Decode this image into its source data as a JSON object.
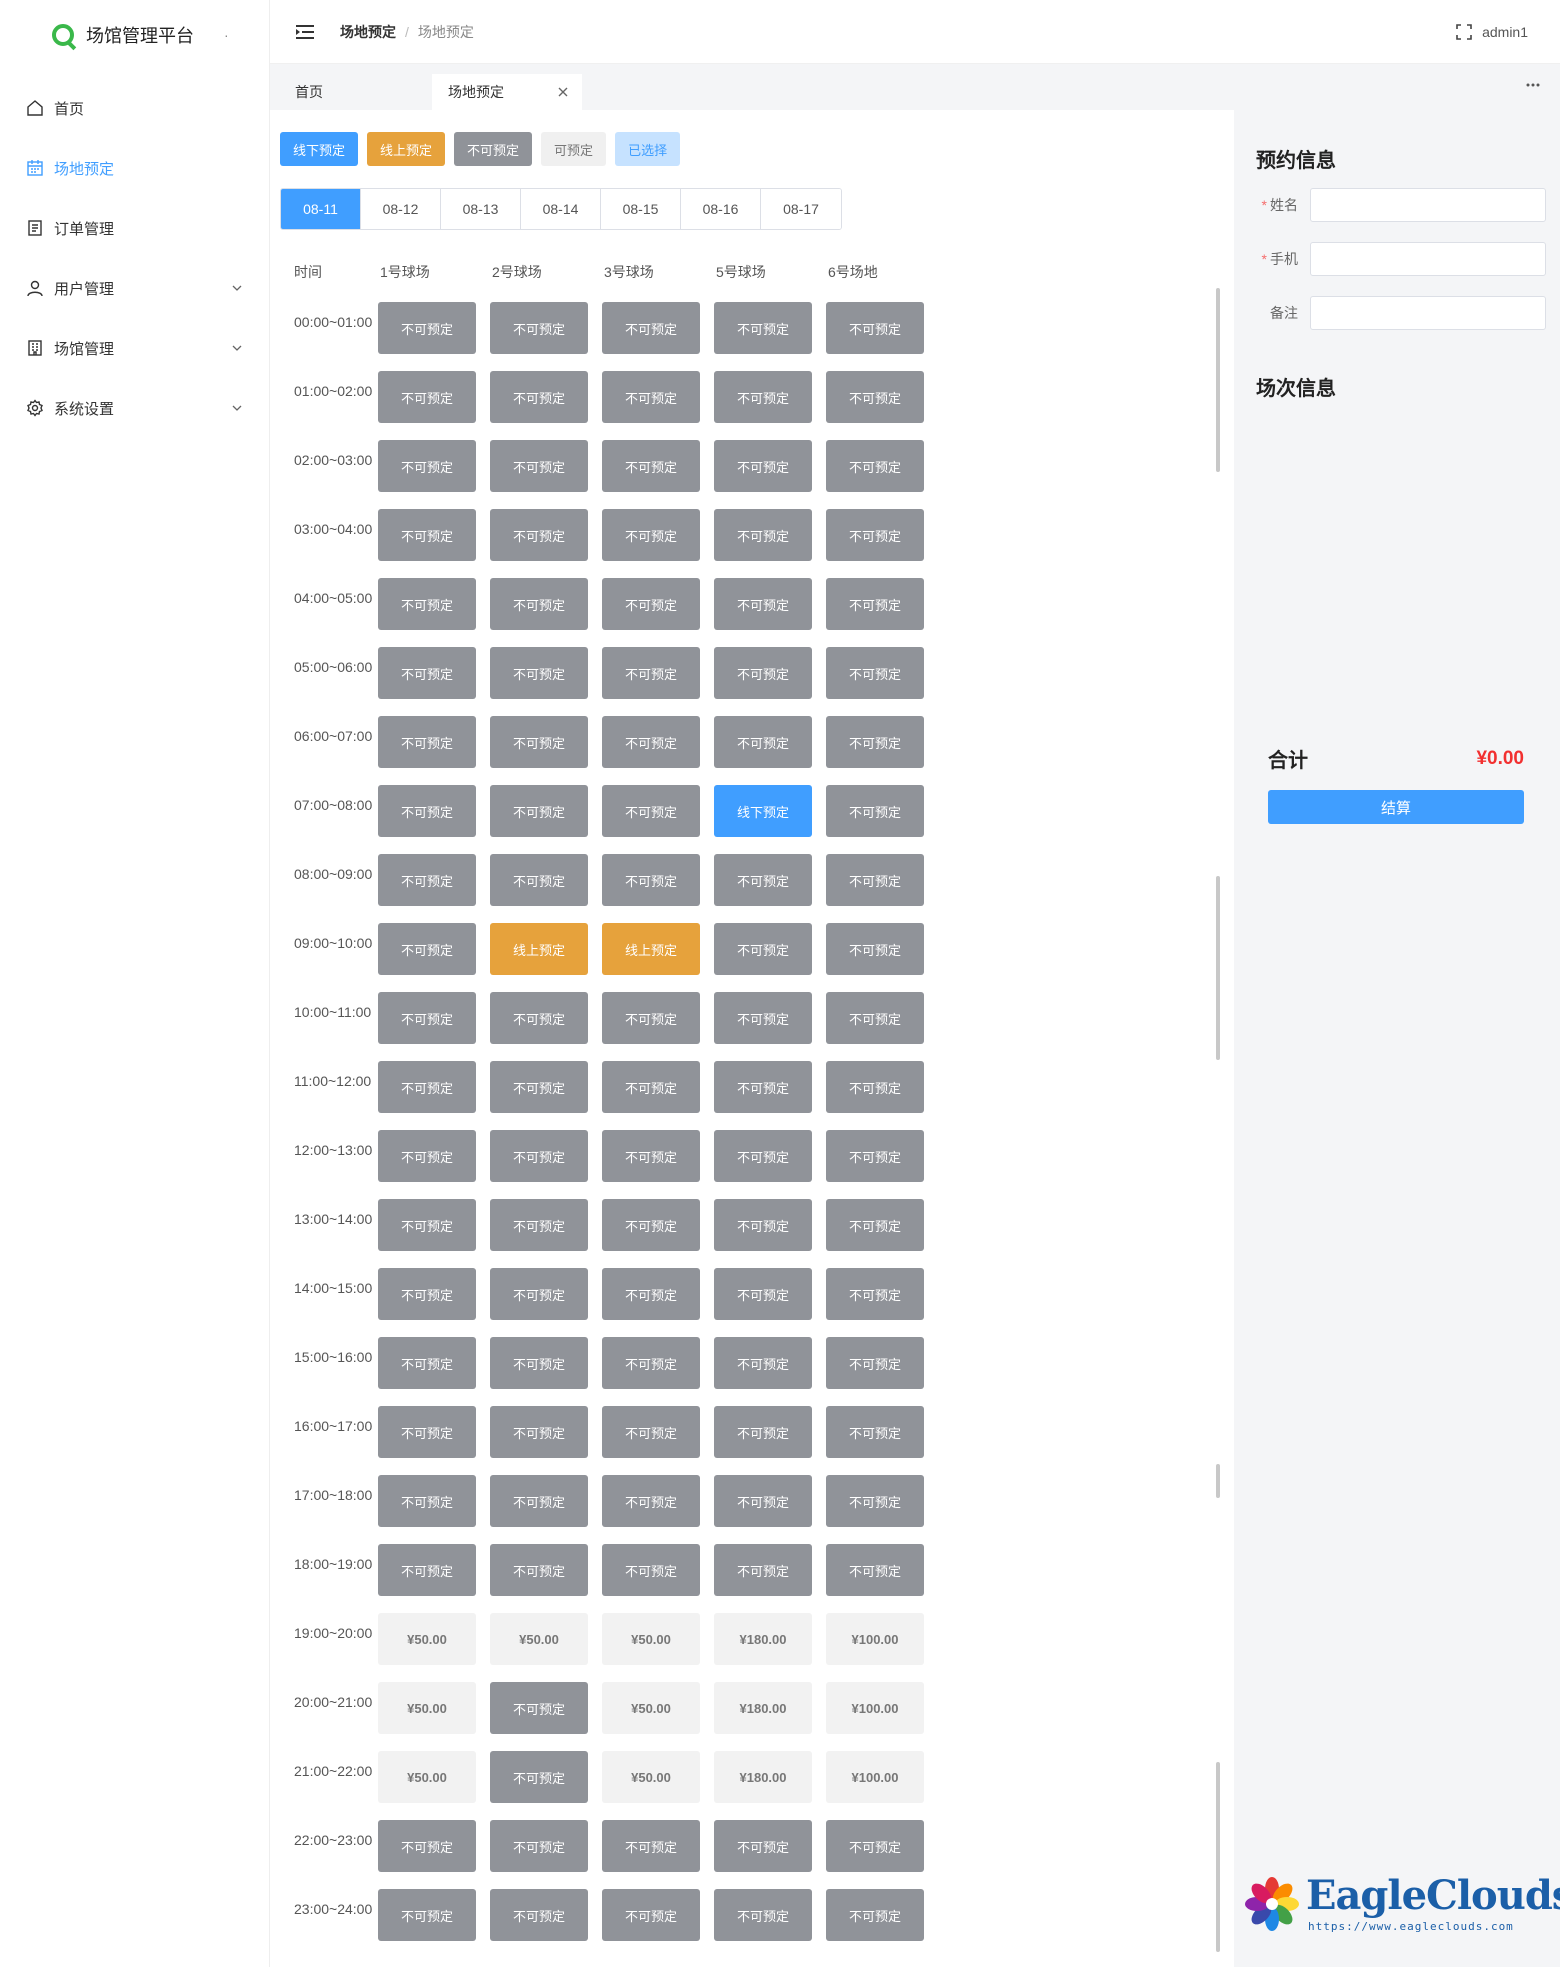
{
  "app": {
    "title": "场馆管理平台",
    "title_dot": "·"
  },
  "sidebar": {
    "items": [
      {
        "label": "首页",
        "icon": "home-icon",
        "active": false,
        "expandable": false
      },
      {
        "label": "场地预定",
        "icon": "calendar-icon",
        "active": true,
        "expandable": false
      },
      {
        "label": "订单管理",
        "icon": "document-icon",
        "active": false,
        "expandable": false
      },
      {
        "label": "用户管理",
        "icon": "user-icon",
        "active": false,
        "expandable": true
      },
      {
        "label": "场馆管理",
        "icon": "building-icon",
        "active": false,
        "expandable": true
      },
      {
        "label": "系统设置",
        "icon": "gear-icon",
        "active": false,
        "expandable": true
      }
    ]
  },
  "header": {
    "breadcrumb": [
      "场地预定",
      "场地预定"
    ],
    "breadcrumb_sep": "/",
    "user": "admin1"
  },
  "tabs": {
    "home": "首页",
    "active": "场地预定"
  },
  "legend": [
    {
      "label": "线下预定",
      "bg": "#409eff",
      "fg": "#ffffff"
    },
    {
      "label": "线上预定",
      "bg": "#e6a23c",
      "fg": "#ffffff"
    },
    {
      "label": "不可预定",
      "bg": "#909399",
      "fg": "#ffffff"
    },
    {
      "label": "可预定",
      "bg": "#f0f0f0",
      "fg": "#777777"
    },
    {
      "label": "已选择",
      "bg": "#c6e2ff",
      "fg": "#409eff"
    }
  ],
  "dates": [
    "08-11",
    "08-12",
    "08-13",
    "08-14",
    "08-15",
    "08-16",
    "08-17"
  ],
  "active_date": 0,
  "grid": {
    "time_header": "时间",
    "venues": [
      "1号球场",
      "2号球场",
      "3号球场",
      "5号球场",
      "6号场地"
    ],
    "labels": {
      "unavailable": "不可预定",
      "offline": "线下预定",
      "online": "线上预定"
    },
    "rows": [
      {
        "time": "00:00~01:00",
        "cells": [
          "X",
          "X",
          "X",
          "X",
          "X"
        ]
      },
      {
        "time": "01:00~02:00",
        "cells": [
          "X",
          "X",
          "X",
          "X",
          "X"
        ]
      },
      {
        "time": "02:00~03:00",
        "cells": [
          "X",
          "X",
          "X",
          "X",
          "X"
        ]
      },
      {
        "time": "03:00~04:00",
        "cells": [
          "X",
          "X",
          "X",
          "X",
          "X"
        ]
      },
      {
        "time": "04:00~05:00",
        "cells": [
          "X",
          "X",
          "X",
          "X",
          "X"
        ]
      },
      {
        "time": "05:00~06:00",
        "cells": [
          "X",
          "X",
          "X",
          "X",
          "X"
        ]
      },
      {
        "time": "06:00~07:00",
        "cells": [
          "X",
          "X",
          "X",
          "X",
          "X"
        ]
      },
      {
        "time": "07:00~08:00",
        "cells": [
          "X",
          "X",
          "X",
          "OFF",
          "X"
        ]
      },
      {
        "time": "08:00~09:00",
        "cells": [
          "X",
          "X",
          "X",
          "X",
          "X"
        ]
      },
      {
        "time": "09:00~10:00",
        "cells": [
          "X",
          "ON",
          "ON",
          "X",
          "X"
        ]
      },
      {
        "time": "10:00~11:00",
        "cells": [
          "X",
          "X",
          "X",
          "X",
          "X"
        ]
      },
      {
        "time": "11:00~12:00",
        "cells": [
          "X",
          "X",
          "X",
          "X",
          "X"
        ]
      },
      {
        "time": "12:00~13:00",
        "cells": [
          "X",
          "X",
          "X",
          "X",
          "X"
        ]
      },
      {
        "time": "13:00~14:00",
        "cells": [
          "X",
          "X",
          "X",
          "X",
          "X"
        ]
      },
      {
        "time": "14:00~15:00",
        "cells": [
          "X",
          "X",
          "X",
          "X",
          "X"
        ]
      },
      {
        "time": "15:00~16:00",
        "cells": [
          "X",
          "X",
          "X",
          "X",
          "X"
        ]
      },
      {
        "time": "16:00~17:00",
        "cells": [
          "X",
          "X",
          "X",
          "X",
          "X"
        ]
      },
      {
        "time": "17:00~18:00",
        "cells": [
          "X",
          "X",
          "X",
          "X",
          "X"
        ]
      },
      {
        "time": "18:00~19:00",
        "cells": [
          "X",
          "X",
          "X",
          "X",
          "X"
        ]
      },
      {
        "time": "19:00~20:00",
        "cells": [
          "¥50.00",
          "¥50.00",
          "¥50.00",
          "¥180.00",
          "¥100.00"
        ]
      },
      {
        "time": "20:00~21:00",
        "cells": [
          "¥50.00",
          "X",
          "¥50.00",
          "¥180.00",
          "¥100.00"
        ]
      },
      {
        "time": "21:00~22:00",
        "cells": [
          "¥50.00",
          "X",
          "¥50.00",
          "¥180.00",
          "¥100.00"
        ]
      },
      {
        "time": "22:00~23:00",
        "cells": [
          "X",
          "X",
          "X",
          "X",
          "X"
        ]
      },
      {
        "time": "23:00~24:00",
        "cells": [
          "X",
          "X",
          "X",
          "X",
          "X"
        ]
      }
    ]
  },
  "panel": {
    "booking_title": "预约信息",
    "fields": [
      {
        "label": "姓名",
        "required": true,
        "value": "",
        "placeholder": ""
      },
      {
        "label": "手机",
        "required": true,
        "value": "",
        "placeholder": ""
      },
      {
        "label": "备注",
        "required": false,
        "value": "",
        "placeholder": ""
      }
    ],
    "session_title": "场次信息",
    "total_label": "合计",
    "total_amount": "¥0.00",
    "settle_label": "结算"
  },
  "watermark": {
    "brand": "EagleClouds",
    "url": "https://www.eagleclouds.com"
  },
  "colors": {
    "primary": "#409eff",
    "online": "#e6a23c",
    "unavailable": "#909399",
    "available_bg": "#f2f2f2",
    "available_fg": "#777777",
    "price_red": "#f23030"
  }
}
